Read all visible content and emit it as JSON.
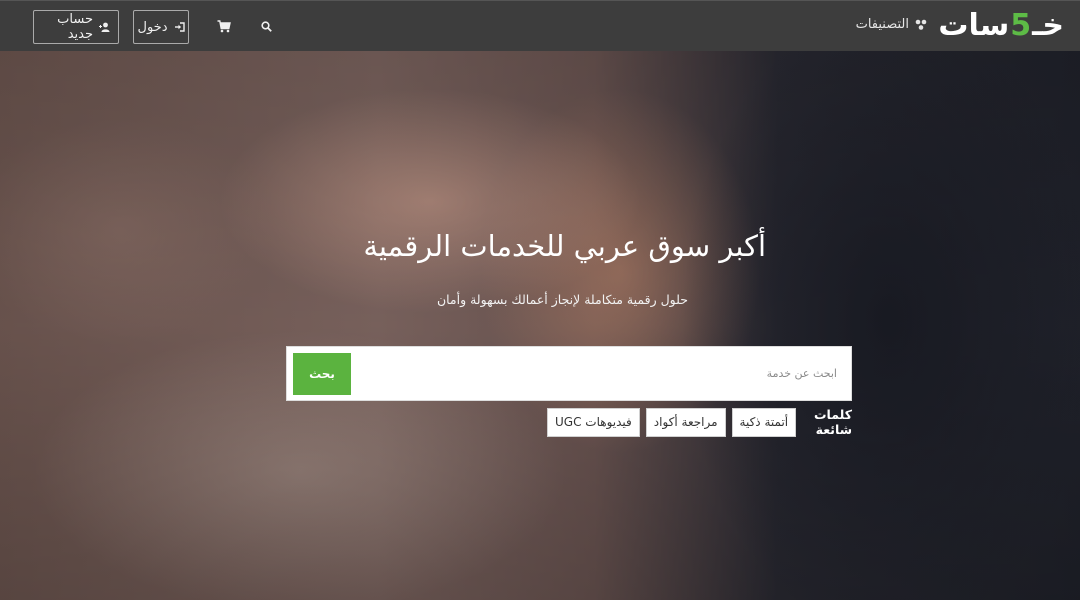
{
  "header": {
    "logo_text": "خمسات",
    "logo_five": "5",
    "categories_label": "التصنيفات",
    "login_label": "دخول",
    "register_label": "حساب جديد"
  },
  "hero": {
    "title": "أكبر سوق عربي للخدمات الرقمية",
    "subtitle": "حلول رقمية متكاملة لإنجاز أعمالك بسهولة وأمان",
    "search_placeholder": "ابحث عن خدمة",
    "search_button": "بحث",
    "popular_label": "كلمات شائعة",
    "popular_tags": [
      "أتمتة ذكية",
      "مراجعة أكواد",
      "فيديوهات UGC"
    ]
  },
  "colors": {
    "brand_green": "#5bb33f",
    "topbar": "#3d3d3d"
  },
  "icons": {
    "categories": "categories-icon",
    "login": "login-icon",
    "register": "user-plus-icon",
    "cart": "cart-icon",
    "search": "search-icon"
  }
}
